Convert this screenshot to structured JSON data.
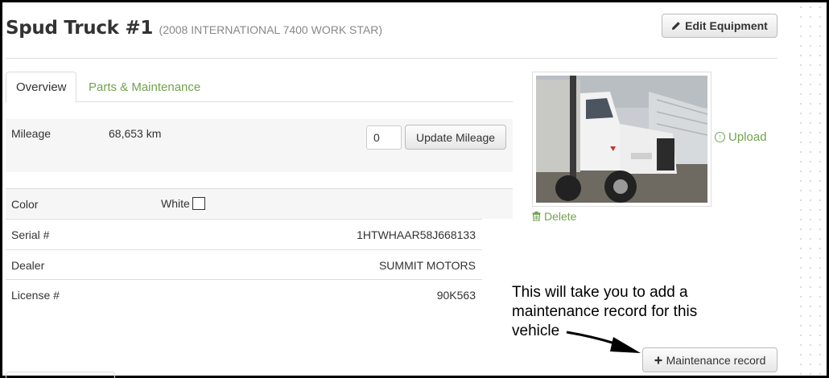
{
  "header": {
    "title": "Spud Truck #1",
    "subtitle": "(2008 INTERNATIONAL 7400 WORK STAR)",
    "edit_label": "Edit Equipment",
    "edit_icon": "pencil-icon"
  },
  "tabs": [
    {
      "label": "Overview",
      "active": true
    },
    {
      "label": "Parts & Maintenance",
      "active": false
    }
  ],
  "mileage": {
    "label": "Mileage",
    "value": "68,653 km",
    "input_value": "0",
    "button_label": "Update Mileage"
  },
  "details": {
    "color": {
      "label": "Color",
      "value": "White",
      "swatch": "#ffffff"
    },
    "serial": {
      "label": "Serial #",
      "value": "1HTWHAAR58J668133"
    },
    "dealer": {
      "label": "Dealer",
      "value": "SUMMIT MOTORS"
    },
    "license": {
      "label": "License #",
      "value": "90K563"
    }
  },
  "photo": {
    "upload_label": "Upload",
    "upload_icon": "circle-arrow-up-icon",
    "delete_label": "Delete",
    "delete_icon": "trash-icon"
  },
  "annotation": {
    "text": "This will take you to add a maintenance record for this vehicle"
  },
  "maintenance": {
    "button_label": "Maintenance record",
    "button_icon": "plus-icon"
  },
  "colors": {
    "accent_green": "#72a24f",
    "border": "#dddddd"
  }
}
